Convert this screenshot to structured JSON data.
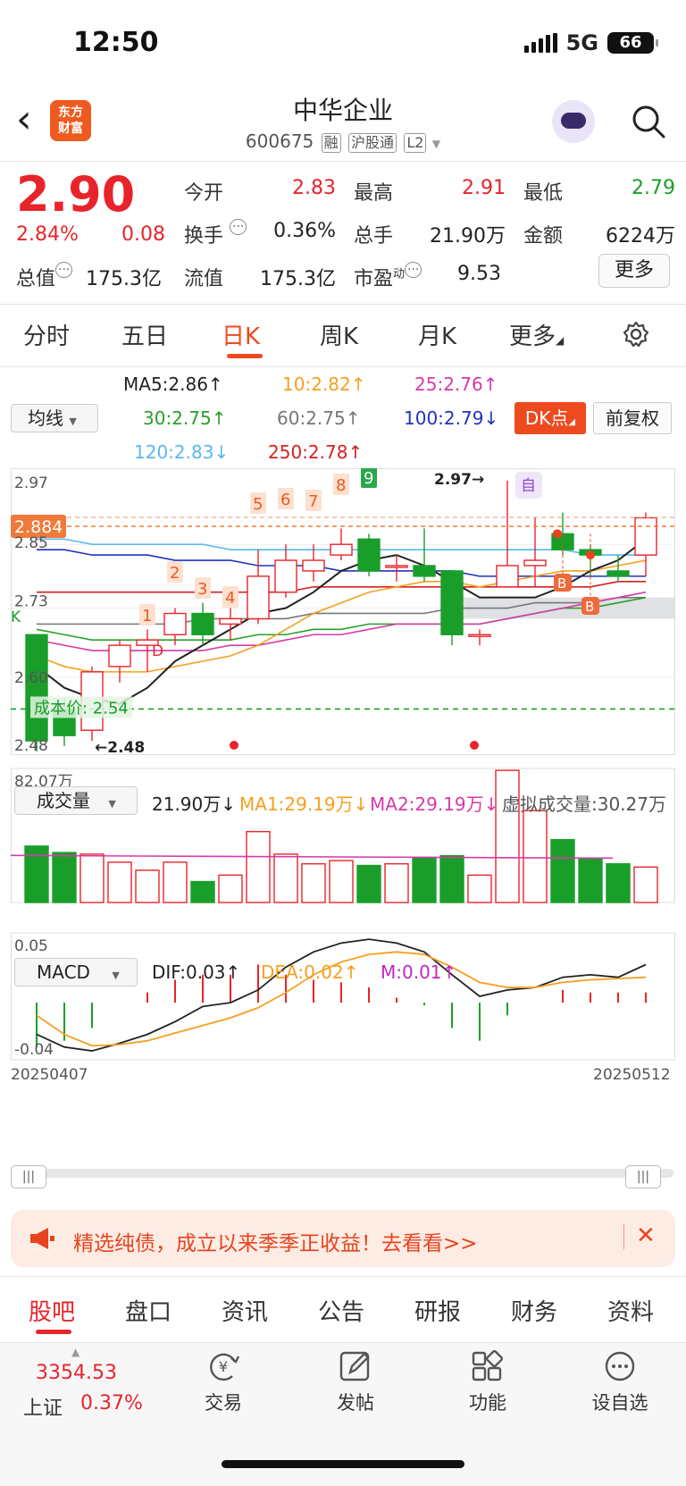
{
  "status": {
    "time": "12:50",
    "network": "5G",
    "battery": "66"
  },
  "header": {
    "logo_line1": "东方",
    "logo_line2": "财富",
    "title": "中华企业",
    "code": "600675",
    "tags": [
      "融",
      "沪股通",
      "L2"
    ]
  },
  "quote": {
    "price": "2.90",
    "change_pct": "2.84%",
    "change": "0.08",
    "rows": [
      [
        {
          "label": "今开",
          "value": "2.83",
          "color": "red"
        },
        {
          "label": "最高",
          "value": "2.91",
          "color": "red"
        },
        {
          "label": "最低",
          "value": "2.79",
          "color": "green"
        }
      ],
      [
        {
          "label": "换手",
          "value": "0.36%",
          "color": "black"
        },
        {
          "label": "总手",
          "value": "21.90万",
          "color": "black"
        },
        {
          "label": "金额",
          "value": "6224万",
          "color": "black"
        }
      ]
    ],
    "total_value_label": "总值",
    "total_value": "175.3亿",
    "float_value_label": "流值",
    "float_value": "175.3亿",
    "pe_label": "市盈",
    "pe_sup": "动",
    "pe_value": "9.53",
    "more_label": "更多"
  },
  "tabs": [
    "分时",
    "五日",
    "日K",
    "周K",
    "月K",
    "更多"
  ],
  "ma_legend": {
    "select_label": "均线",
    "ma5": "MA5:2.86↑",
    "ma10": "10:2.82↑",
    "ma25": "25:2.76↑",
    "ma30": "30:2.75↑",
    "ma60": "60:2.75↑",
    "ma100": "100:2.79↓",
    "ma120": "120:2.83↓",
    "ma250": "250:2.78↑",
    "dk_label": "DK点",
    "fq_label": "前复权"
  },
  "colors": {
    "up": "#e8242b",
    "down": "#1a9e2a",
    "accent": "#ee4a1f",
    "ma5": "#222222",
    "ma10": "#f4a020",
    "ma25": "#d63aa8",
    "ma30": "#2aa02a",
    "ma60": "#777777",
    "ma100": "#2233bb",
    "ma120": "#5bb8ee",
    "ma250": "#d42020"
  },
  "chart_data": [
    {
      "type": "candlestick",
      "y_top_label": "2.97",
      "y_mid_label": "2.73",
      "y_low_label": "2.60",
      "y_bottom_label": "2.48",
      "y_third_label": "2.85",
      "ylim": [
        2.455,
        2.99
      ],
      "current_price_tag": "2.884",
      "high_annotation": "2.97→",
      "low_annotation": "←2.48",
      "cost_label": "成本价: 2.54",
      "self_tag": "自",
      "k_tag": "K",
      "d_tag": "D",
      "b_tag": "B",
      "sequence_labels": [
        "1",
        "2",
        "3",
        "4",
        "5",
        "6",
        "7",
        "8",
        "9"
      ],
      "x_start": "20250407",
      "x_end": "20250512",
      "candles": [
        {
          "o": 2.68,
          "c": 2.48,
          "h": 2.68,
          "l": 2.46
        },
        {
          "o": 2.54,
          "c": 2.49,
          "h": 2.56,
          "l": 2.47
        },
        {
          "o": 2.5,
          "c": 2.61,
          "h": 2.62,
          "l": 2.48
        },
        {
          "o": 2.62,
          "c": 2.66,
          "h": 2.67,
          "l": 2.59
        },
        {
          "o": 2.66,
          "c": 2.67,
          "h": 2.69,
          "l": 2.61
        },
        {
          "o": 2.68,
          "c": 2.72,
          "h": 2.73,
          "l": 2.66
        },
        {
          "o": 2.72,
          "c": 2.68,
          "h": 2.74,
          "l": 2.66
        },
        {
          "o": 2.7,
          "c": 2.71,
          "h": 2.73,
          "l": 2.67
        },
        {
          "o": 2.71,
          "c": 2.79,
          "h": 2.84,
          "l": 2.7
        },
        {
          "o": 2.76,
          "c": 2.82,
          "h": 2.85,
          "l": 2.75
        },
        {
          "o": 2.8,
          "c": 2.82,
          "h": 2.85,
          "l": 2.78
        },
        {
          "o": 2.83,
          "c": 2.85,
          "h": 2.88,
          "l": 2.82
        },
        {
          "o": 2.86,
          "c": 2.8,
          "h": 2.87,
          "l": 2.79
        },
        {
          "o": 2.81,
          "c": 2.81,
          "h": 2.83,
          "l": 2.78
        },
        {
          "o": 2.81,
          "c": 2.79,
          "h": 2.88,
          "l": 2.78
        },
        {
          "o": 2.8,
          "c": 2.68,
          "h": 2.8,
          "l": 2.66
        },
        {
          "o": 2.68,
          "c": 2.68,
          "h": 2.69,
          "l": 2.66
        },
        {
          "o": 2.77,
          "c": 2.81,
          "h": 2.97,
          "l": 2.77
        },
        {
          "o": 2.81,
          "c": 2.82,
          "h": 2.9,
          "l": 2.77
        },
        {
          "o": 2.87,
          "c": 2.84,
          "h": 2.91,
          "l": 2.83
        },
        {
          "o": 2.84,
          "c": 2.83,
          "h": 2.85,
          "l": 2.79
        },
        {
          "o": 2.8,
          "c": 2.79,
          "h": 2.83,
          "l": 2.78
        },
        {
          "o": 2.83,
          "c": 2.9,
          "h": 2.91,
          "l": 2.79
        }
      ],
      "volume": {
        "select_label": "成交量",
        "current": "21.90万↓",
        "ma1": "MA1:29.19万↓",
        "ma2": "MA2:29.19万↓",
        "virtual": "虚拟成交量:30.27万",
        "max_label": "82.07万",
        "values": [
          35,
          31,
          30,
          25,
          20,
          25,
          13,
          17,
          44,
          30,
          24,
          26,
          23,
          24,
          28,
          29,
          17,
          82,
          57,
          39,
          27,
          24,
          22
        ]
      },
      "macd": {
        "select_label": "MACD",
        "dif": "DIF:0.03↑",
        "dea": "DEA:0.02↑",
        "m": "M:0.01↑",
        "top_label": "0.05",
        "bottom_label": "-0.04",
        "hist": [
          -0.035,
          -0.03,
          -0.02,
          0.0,
          0.008,
          0.018,
          0.022,
          0.022,
          0.03,
          0.022,
          0.018,
          0.016,
          0.012,
          0.004,
          -0.002,
          -0.02,
          -0.03,
          -0.01,
          0.0,
          0.01,
          0.008,
          0.008,
          0.008
        ],
        "dif_line": [
          -0.025,
          -0.035,
          -0.038,
          -0.032,
          -0.025,
          -0.015,
          -0.003,
          0.0,
          0.01,
          0.028,
          0.04,
          0.047,
          0.05,
          0.047,
          0.04,
          0.022,
          0.005,
          0.01,
          0.012,
          0.02,
          0.022,
          0.02,
          0.03
        ],
        "dea_line": [
          -0.01,
          -0.025,
          -0.034,
          -0.033,
          -0.03,
          -0.024,
          -0.018,
          -0.012,
          -0.004,
          0.008,
          0.022,
          0.032,
          0.038,
          0.04,
          0.038,
          0.028,
          0.016,
          0.012,
          0.012,
          0.016,
          0.018,
          0.019,
          0.02
        ]
      }
    }
  ],
  "promo": {
    "text": "精选纯债，成立以来季季正收益！去看看>>"
  },
  "bottom_tabs": [
    "股吧",
    "盘口",
    "资讯",
    "公告",
    "研报",
    "财务",
    "资料"
  ],
  "bottom_bar": {
    "index_value": "3354.53",
    "index_name": "上证",
    "index_pct": "0.37%",
    "buttons": [
      "交易",
      "发帖",
      "功能",
      "设自选"
    ]
  }
}
